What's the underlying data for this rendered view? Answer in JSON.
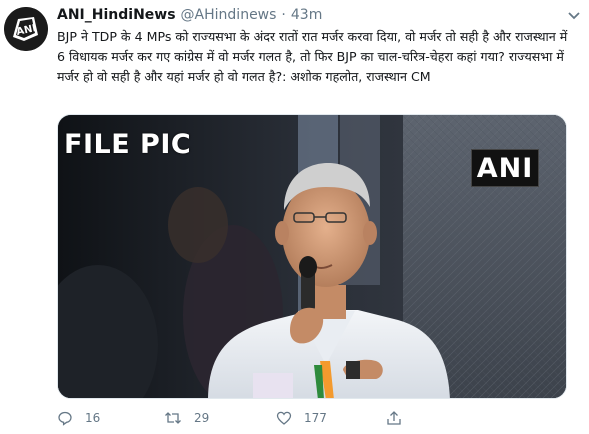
{
  "tweet": {
    "display_name": "ANI_HindiNews",
    "handle": "@AHindinews",
    "separator": "·",
    "time": "43m",
    "text": "BJP ने TDP के 4 MPs को राज्यसभा के अंदर रातों रात मर्जर करवा दिया, वो मर्जर तो सही है और राजस्थान में 6 विधायक मर्जर कर गए कांग्रेस में वो मर्जर गलत है, तो फिर BJP का चाल-चरित्र-चेहरा कहां गया? राज्यसभा में मर्जर हो वो सही है और यहां मर्जर हो वो गलत है?: अशोक गहलोत, राजस्थान CM",
    "avatar_text": "ANI",
    "media": {
      "overlay_text": "FILE PIC",
      "watermark": "ANI"
    },
    "actions": {
      "reply_count": "16",
      "retweet_count": "29",
      "like_count": "177"
    },
    "icons": [
      "avatar-logo-icon",
      "caret-down-icon",
      "reply-icon",
      "retweet-icon",
      "like-icon",
      "share-icon"
    ],
    "colors": {
      "text": "#14171a",
      "muted": "#657786",
      "border": "#e1e8ed"
    }
  }
}
